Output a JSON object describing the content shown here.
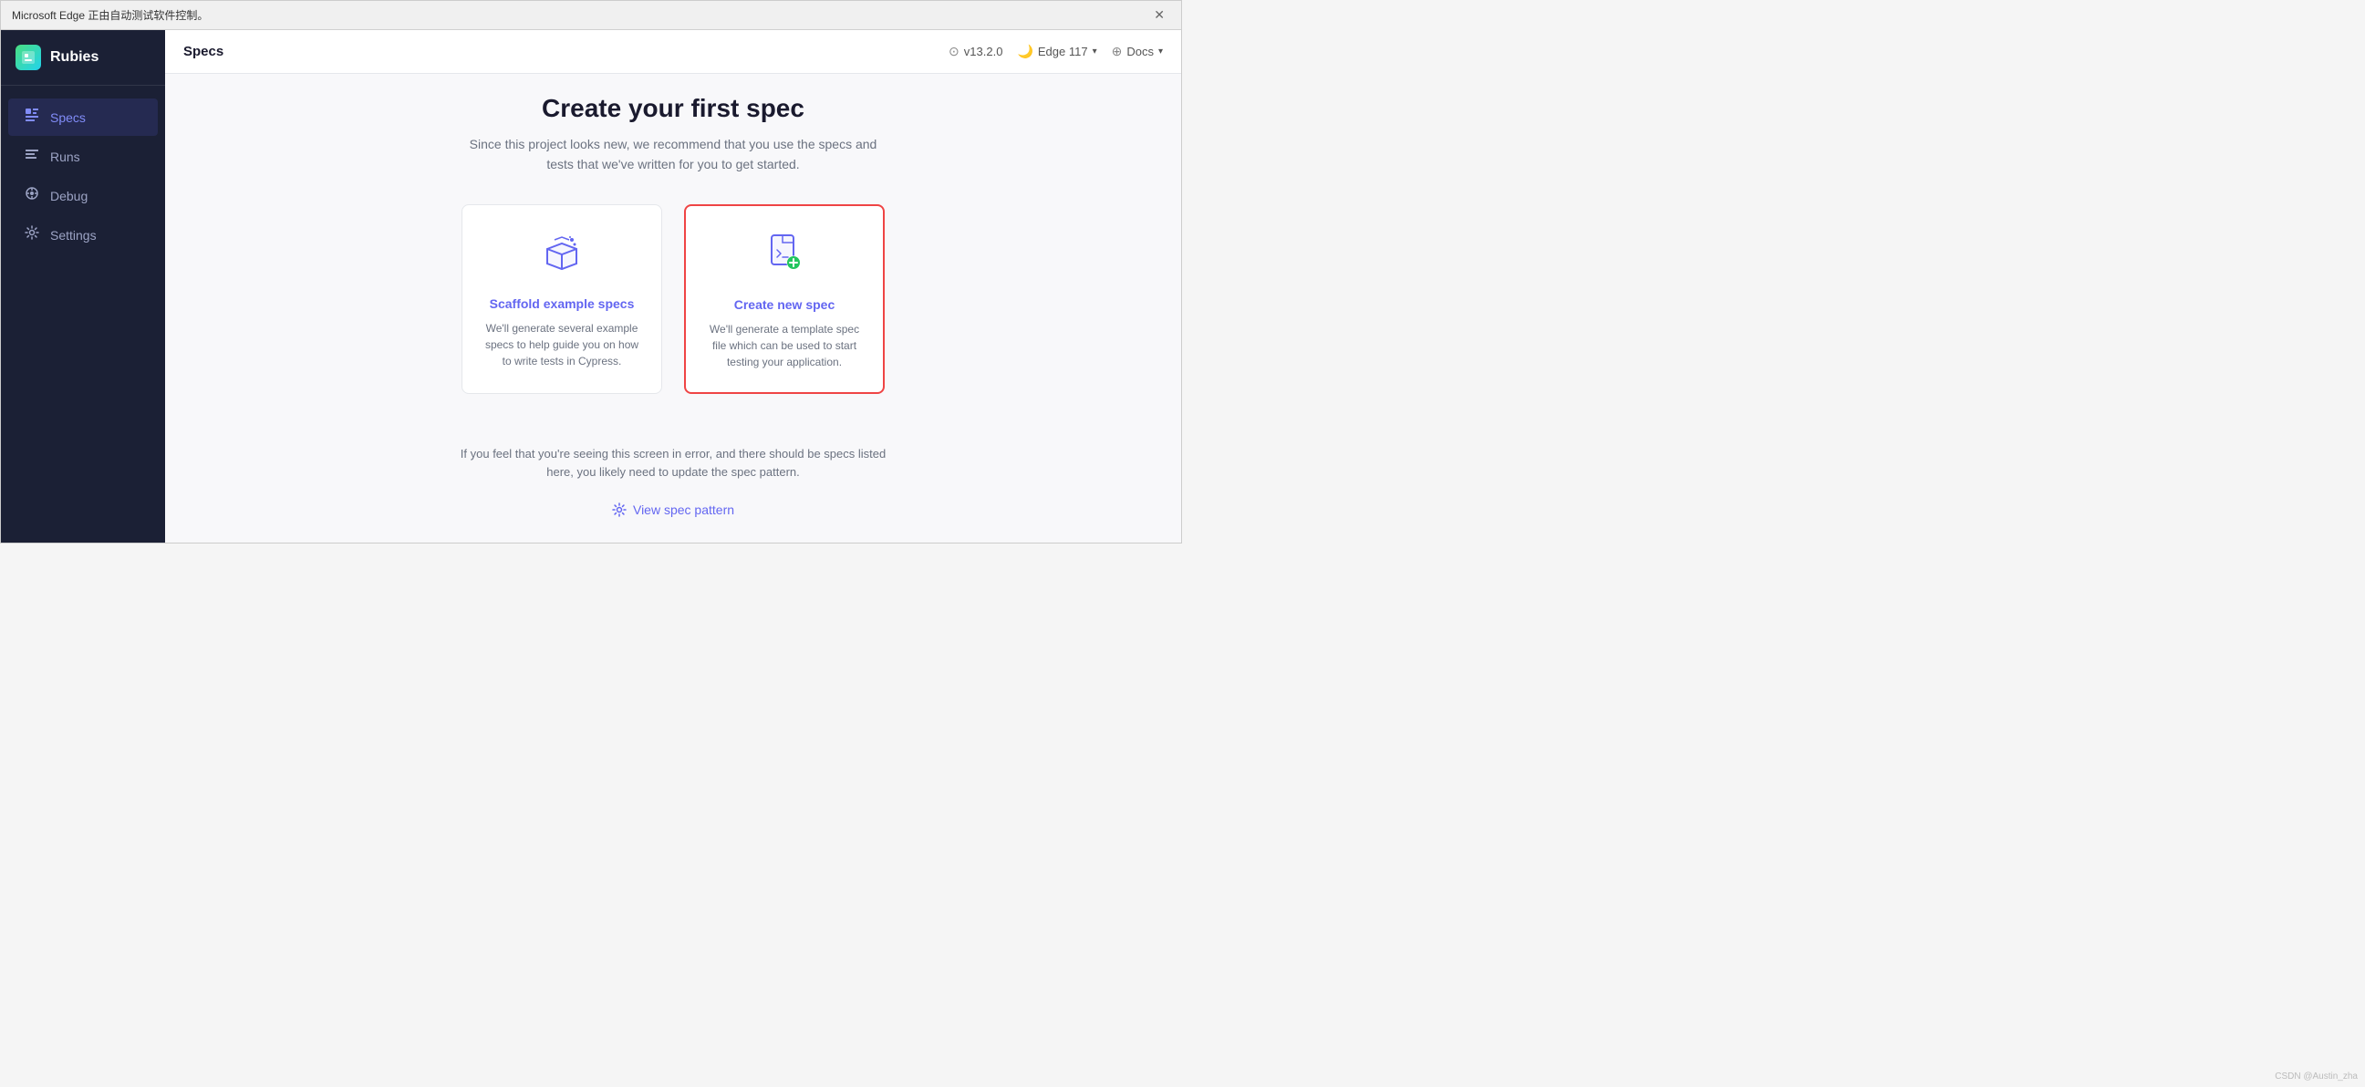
{
  "window": {
    "title_bar_text": "Microsoft Edge 正由自动测试软件控制。",
    "close_label": "✕"
  },
  "sidebar": {
    "logo": {
      "text": "Rubies",
      "icon_char": "◆"
    },
    "items": [
      {
        "id": "specs",
        "label": "Specs",
        "icon": "▣",
        "active": true
      },
      {
        "id": "runs",
        "label": "Runs",
        "icon": "≡",
        "active": false
      },
      {
        "id": "debug",
        "label": "Debug",
        "icon": "⚙",
        "active": false
      },
      {
        "id": "settings",
        "label": "Settings",
        "icon": "⚙",
        "active": false
      }
    ]
  },
  "topbar": {
    "title": "Specs",
    "version": "v13.2.0",
    "browser_label": "Edge 117",
    "docs_label": "Docs",
    "chevron": "▾"
  },
  "main": {
    "heading": "Create your first spec",
    "subtext": "Since this project looks new, we recommend that you use the specs\nand tests that we've written for you to get started.",
    "cards": [
      {
        "id": "scaffold",
        "title": "Scaffold example\nspecs",
        "desc": "We'll generate several example specs to help guide you on how to write tests in Cypress.",
        "highlighted": false
      },
      {
        "id": "create-new",
        "title": "Create new spec",
        "desc": "We'll generate a template spec file which can be used to start testing your application.",
        "highlighted": true
      }
    ],
    "error_text": "If you feel that you're seeing this screen in error, and there should be specs listed\nhere, you likely need to update the spec pattern.",
    "view_pattern_label": "View spec pattern"
  },
  "watermark": "CSDN @Austin_zha"
}
